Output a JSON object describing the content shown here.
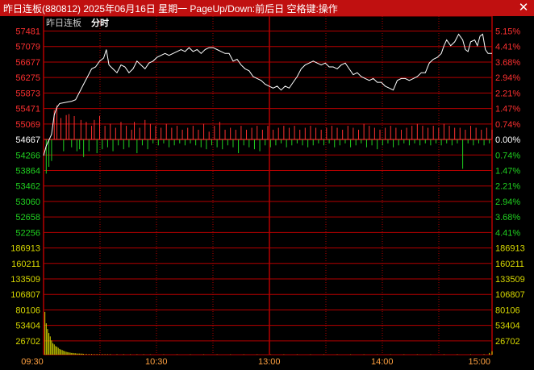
{
  "window": {
    "title": "昨日连板(880812) 2025年06月16日 星期一 PageUp/Down:前后日 空格键:操作",
    "close_icon": "close-icon"
  },
  "chart_header": {
    "name": "昨日连板",
    "mode": "分时"
  },
  "colors": {
    "up": "#ff3030",
    "down": "#20d020",
    "base": "#ffffff",
    "volume": "#d8d800",
    "grid": "#b40000",
    "time": "#ffa040"
  },
  "chart_data": {
    "type": "line",
    "base_price": 54667,
    "price_axis": [
      "57481",
      "57079",
      "56677",
      "56275",
      "55873",
      "55471",
      "55069",
      "54667",
      "54266",
      "53864",
      "53462",
      "53060",
      "52658",
      "52256"
    ],
    "pct_axis": [
      "5.15%",
      "4.41%",
      "3.68%",
      "2.94%",
      "2.21%",
      "1.47%",
      "0.74%",
      "0.00%",
      "0.74%",
      "1.47%",
      "2.21%",
      "2.94%",
      "3.68%",
      "4.41%"
    ],
    "volume_axis": [
      "186913",
      "160211",
      "133509",
      "106807",
      "80106",
      "53404",
      "26702"
    ],
    "time_labels": [
      "09:30",
      "10:30",
      "13:00",
      "14:00",
      "15:00"
    ],
    "ylim": [
      52256,
      57481
    ],
    "volume_max": 186913,
    "price_series": [
      [
        0,
        54250
      ],
      [
        2,
        54500
      ],
      [
        4,
        54650
      ],
      [
        6,
        54800
      ],
      [
        8,
        55300
      ],
      [
        10,
        55500
      ],
      [
        12,
        55600
      ],
      [
        15,
        55620
      ],
      [
        18,
        55640
      ],
      [
        21,
        55660
      ],
      [
        24,
        55700
      ],
      [
        27,
        55900
      ],
      [
        30,
        56100
      ],
      [
        33,
        56300
      ],
      [
        36,
        56500
      ],
      [
        39,
        56550
      ],
      [
        42,
        56700
      ],
      [
        45,
        56780
      ],
      [
        47,
        57000
      ],
      [
        49,
        56600
      ],
      [
        52,
        56500
      ],
      [
        55,
        56400
      ],
      [
        58,
        56600
      ],
      [
        61,
        56550
      ],
      [
        64,
        56400
      ],
      [
        67,
        56500
      ],
      [
        70,
        56700
      ],
      [
        73,
        56600
      ],
      [
        76,
        56500
      ],
      [
        79,
        56650
      ],
      [
        82,
        56700
      ],
      [
        85,
        56800
      ],
      [
        88,
        56850
      ],
      [
        91,
        56900
      ],
      [
        94,
        56850
      ],
      [
        97,
        56900
      ],
      [
        100,
        56950
      ],
      [
        103,
        57000
      ],
      [
        106,
        56950
      ],
      [
        109,
        57050
      ],
      [
        112,
        56950
      ],
      [
        115,
        57000
      ],
      [
        118,
        56900
      ],
      [
        121,
        57000
      ],
      [
        124,
        57050
      ],
      [
        127,
        57050
      ],
      [
        130,
        57000
      ],
      [
        133,
        56950
      ],
      [
        136,
        56900
      ],
      [
        139,
        56900
      ],
      [
        142,
        56700
      ],
      [
        145,
        56750
      ],
      [
        148,
        56600
      ],
      [
        151,
        56500
      ],
      [
        154,
        56450
      ],
      [
        157,
        56300
      ],
      [
        160,
        56250
      ],
      [
        163,
        56200
      ],
      [
        166,
        56100
      ],
      [
        169,
        56050
      ],
      [
        172,
        56000
      ],
      [
        175,
        56050
      ],
      [
        178,
        55950
      ],
      [
        181,
        56050
      ],
      [
        184,
        56000
      ],
      [
        187,
        56150
      ],
      [
        190,
        56300
      ],
      [
        193,
        56500
      ],
      [
        196,
        56600
      ],
      [
        199,
        56650
      ],
      [
        202,
        56700
      ],
      [
        205,
        56650
      ],
      [
        208,
        56600
      ],
      [
        211,
        56650
      ],
      [
        214,
        56550
      ],
      [
        217,
        56550
      ],
      [
        220,
        56500
      ],
      [
        223,
        56600
      ],
      [
        226,
        56650
      ],
      [
        229,
        56500
      ],
      [
        232,
        56350
      ],
      [
        235,
        56400
      ],
      [
        238,
        56300
      ],
      [
        241,
        56250
      ],
      [
        244,
        56200
      ],
      [
        247,
        56250
      ],
      [
        250,
        56150
      ],
      [
        253,
        56150
      ],
      [
        256,
        56050
      ],
      [
        259,
        56000
      ],
      [
        262,
        55950
      ],
      [
        265,
        56200
      ],
      [
        268,
        56250
      ],
      [
        271,
        56250
      ],
      [
        274,
        56200
      ],
      [
        277,
        56250
      ],
      [
        280,
        56300
      ],
      [
        283,
        56400
      ],
      [
        286,
        56400
      ],
      [
        289,
        56650
      ],
      [
        292,
        56750
      ],
      [
        295,
        56800
      ],
      [
        298,
        56900
      ],
      [
        300,
        57100
      ],
      [
        302,
        57250
      ],
      [
        305,
        57100
      ],
      [
        308,
        57200
      ],
      [
        311,
        57400
      ],
      [
        314,
        57250
      ],
      [
        316,
        57000
      ],
      [
        318,
        56950
      ],
      [
        320,
        57200
      ],
      [
        323,
        57250
      ],
      [
        325,
        57100
      ],
      [
        327,
        57350
      ],
      [
        329,
        57400
      ],
      [
        331,
        57000
      ],
      [
        333,
        56900
      ],
      [
        336,
        56900
      ]
    ],
    "change_bars": [
      [
        2,
        -35
      ],
      [
        4,
        -28
      ],
      [
        6,
        -22
      ],
      [
        8,
        30
      ],
      [
        10,
        35
      ],
      [
        13,
        22
      ],
      [
        15,
        -12
      ],
      [
        17,
        25
      ],
      [
        19,
        26
      ],
      [
        21,
        -8
      ],
      [
        23,
        24
      ],
      [
        25,
        -12
      ],
      [
        27,
        -10
      ],
      [
        28,
        20
      ],
      [
        30,
        -18
      ],
      [
        32,
        18
      ],
      [
        34,
        -12
      ],
      [
        36,
        14
      ],
      [
        38,
        20
      ],
      [
        40,
        -14
      ],
      [
        42,
        24
      ],
      [
        44,
        -10
      ],
      [
        46,
        14
      ],
      [
        48,
        -8
      ],
      [
        50,
        16
      ],
      [
        52,
        -12
      ],
      [
        54,
        12
      ],
      [
        56,
        -6
      ],
      [
        58,
        18
      ],
      [
        60,
        -10
      ],
      [
        62,
        14
      ],
      [
        64,
        -8
      ],
      [
        66,
        10
      ],
      [
        68,
        18
      ],
      [
        70,
        -14
      ],
      [
        72,
        12
      ],
      [
        74,
        -6
      ],
      [
        76,
        20
      ],
      [
        78,
        -10
      ],
      [
        80,
        16
      ],
      [
        82,
        -4
      ],
      [
        84,
        14
      ],
      [
        86,
        -6
      ],
      [
        88,
        12
      ],
      [
        90,
        -4
      ],
      [
        92,
        16
      ],
      [
        94,
        -8
      ],
      [
        96,
        12
      ],
      [
        98,
        -6
      ],
      [
        100,
        14
      ],
      [
        102,
        -4
      ],
      [
        104,
        10
      ],
      [
        106,
        -6
      ],
      [
        108,
        12
      ],
      [
        110,
        -4
      ],
      [
        112,
        14
      ],
      [
        114,
        -6
      ],
      [
        116,
        10
      ],
      [
        118,
        -8
      ],
      [
        120,
        16
      ],
      [
        122,
        -10
      ],
      [
        124,
        8
      ],
      [
        126,
        -6
      ],
      [
        128,
        14
      ],
      [
        130,
        -8
      ],
      [
        132,
        18
      ],
      [
        134,
        -10
      ],
      [
        136,
        10
      ],
      [
        138,
        -6
      ],
      [
        140,
        12
      ],
      [
        142,
        -8
      ],
      [
        144,
        10
      ],
      [
        146,
        -14
      ],
      [
        148,
        14
      ],
      [
        150,
        -6
      ],
      [
        152,
        10
      ],
      [
        154,
        -8
      ],
      [
        156,
        12
      ],
      [
        158,
        -10
      ],
      [
        160,
        14
      ],
      [
        162,
        -12
      ],
      [
        164,
        10
      ],
      [
        166,
        -6
      ],
      [
        168,
        14
      ],
      [
        170,
        -8
      ],
      [
        172,
        10
      ],
      [
        174,
        -6
      ],
      [
        176,
        12
      ],
      [
        178,
        -4
      ],
      [
        180,
        14
      ],
      [
        182,
        -8
      ],
      [
        184,
        12
      ],
      [
        186,
        -6
      ],
      [
        188,
        14
      ],
      [
        190,
        -4
      ],
      [
        192,
        10
      ],
      [
        194,
        -6
      ],
      [
        196,
        12
      ],
      [
        198,
        -8
      ],
      [
        200,
        14
      ],
      [
        202,
        -6
      ],
      [
        204,
        12
      ],
      [
        206,
        -4
      ],
      [
        208,
        10
      ],
      [
        210,
        -6
      ],
      [
        212,
        12
      ],
      [
        214,
        -4
      ],
      [
        216,
        14
      ],
      [
        218,
        -8
      ],
      [
        220,
        12
      ],
      [
        222,
        -6
      ],
      [
        224,
        10
      ],
      [
        226,
        -4
      ],
      [
        228,
        14
      ],
      [
        230,
        -8
      ],
      [
        232,
        12
      ],
      [
        234,
        -6
      ],
      [
        236,
        10
      ],
      [
        238,
        -4
      ],
      [
        240,
        16
      ],
      [
        242,
        -8
      ],
      [
        244,
        14
      ],
      [
        246,
        -6
      ],
      [
        248,
        12
      ],
      [
        250,
        -10
      ],
      [
        252,
        10
      ],
      [
        254,
        -6
      ],
      [
        256,
        12
      ],
      [
        258,
        -4
      ],
      [
        260,
        14
      ],
      [
        262,
        -8
      ],
      [
        264,
        12
      ],
      [
        266,
        -6
      ],
      [
        268,
        10
      ],
      [
        270,
        -4
      ],
      [
        272,
        12
      ],
      [
        274,
        -6
      ],
      [
        276,
        14
      ],
      [
        278,
        -4
      ],
      [
        280,
        16
      ],
      [
        282,
        -6
      ],
      [
        284,
        14
      ],
      [
        286,
        -4
      ],
      [
        288,
        12
      ],
      [
        290,
        -6
      ],
      [
        292,
        14
      ],
      [
        294,
        -4
      ],
      [
        296,
        12
      ],
      [
        298,
        -6
      ],
      [
        300,
        16
      ],
      [
        302,
        -4
      ],
      [
        304,
        14
      ],
      [
        306,
        -6
      ],
      [
        308,
        12
      ],
      [
        310,
        -4
      ],
      [
        312,
        12
      ],
      [
        314,
        -30
      ],
      [
        316,
        10
      ],
      [
        318,
        -4
      ],
      [
        320,
        14
      ],
      [
        322,
        -6
      ],
      [
        324,
        12
      ],
      [
        326,
        -4
      ],
      [
        328,
        10
      ],
      [
        330,
        -6
      ],
      [
        332,
        12
      ],
      [
        334,
        -4
      ],
      [
        336,
        10
      ]
    ],
    "volume_series": [
      [
        1,
        75000
      ],
      [
        2,
        55000
      ],
      [
        3,
        45000
      ],
      [
        4,
        38000
      ],
      [
        5,
        32000
      ],
      [
        6,
        25000
      ],
      [
        7,
        20000
      ],
      [
        8,
        18000
      ],
      [
        9,
        15000
      ],
      [
        10,
        14000
      ],
      [
        11,
        12000
      ],
      [
        12,
        10000
      ],
      [
        13,
        9000
      ],
      [
        14,
        8000
      ],
      [
        15,
        7000
      ],
      [
        16,
        6000
      ],
      [
        17,
        5000
      ],
      [
        18,
        4500
      ],
      [
        19,
        4000
      ],
      [
        20,
        3500
      ],
      [
        21,
        3000
      ],
      [
        22,
        3000
      ],
      [
        23,
        2500
      ],
      [
        24,
        2500
      ],
      [
        25,
        2000
      ],
      [
        26,
        2000
      ],
      [
        27,
        2000
      ],
      [
        28,
        1800
      ],
      [
        29,
        1800
      ],
      [
        30,
        1500
      ],
      [
        32,
        1500
      ],
      [
        34,
        1200
      ],
      [
        36,
        1200
      ],
      [
        38,
        1000
      ],
      [
        40,
        1000
      ],
      [
        42,
        900
      ],
      [
        44,
        900
      ],
      [
        46,
        800
      ],
      [
        48,
        800
      ],
      [
        50,
        800
      ],
      [
        55,
        700
      ],
      [
        60,
        700
      ],
      [
        65,
        600
      ],
      [
        70,
        600
      ],
      [
        75,
        600
      ],
      [
        80,
        500
      ],
      [
        90,
        500
      ],
      [
        100,
        500
      ],
      [
        110,
        500
      ],
      [
        120,
        500
      ],
      [
        130,
        500
      ],
      [
        140,
        500
      ],
      [
        150,
        500
      ],
      [
        160,
        500
      ],
      [
        170,
        500
      ],
      [
        180,
        500
      ],
      [
        190,
        500
      ],
      [
        200,
        500
      ],
      [
        210,
        500
      ],
      [
        220,
        500
      ],
      [
        230,
        500
      ],
      [
        240,
        500
      ],
      [
        250,
        500
      ],
      [
        260,
        500
      ],
      [
        270,
        500
      ],
      [
        280,
        500
      ],
      [
        290,
        500
      ],
      [
        300,
        600
      ],
      [
        310,
        600
      ],
      [
        320,
        700
      ],
      [
        330,
        800
      ],
      [
        334,
        3000
      ],
      [
        336,
        6000
      ]
    ]
  }
}
